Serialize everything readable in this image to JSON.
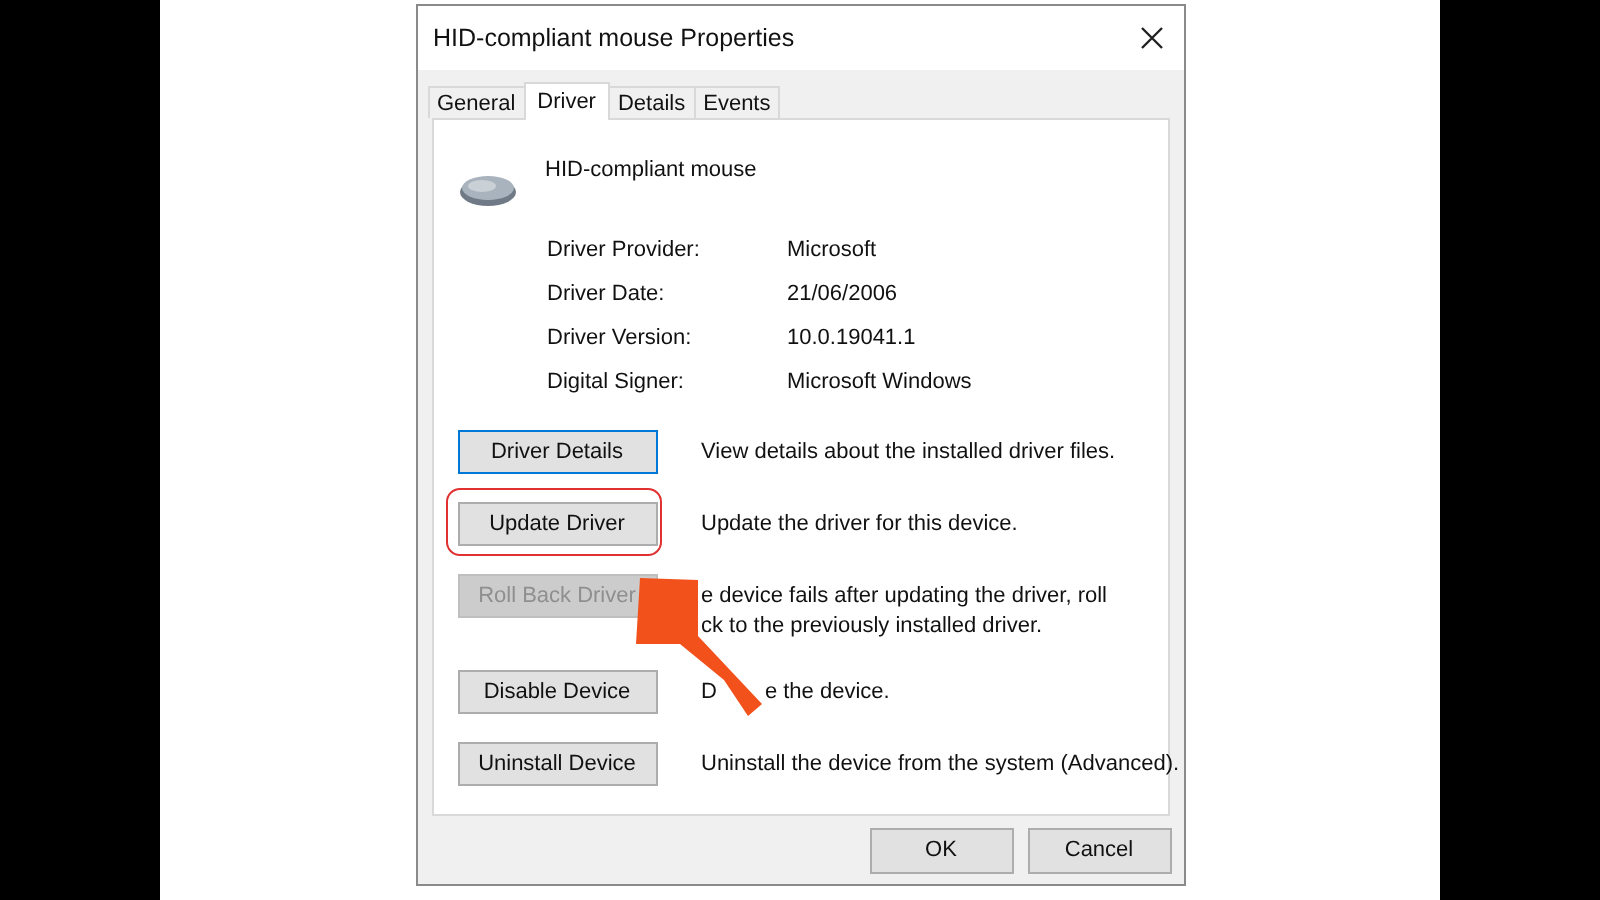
{
  "window": {
    "title": "HID-compliant mouse Properties"
  },
  "tabs": [
    {
      "label": "General",
      "selected": false
    },
    {
      "label": "Driver",
      "selected": true
    },
    {
      "label": "Details",
      "selected": false
    },
    {
      "label": "Events",
      "selected": false
    }
  ],
  "device": {
    "name": "HID-compliant mouse"
  },
  "properties": [
    {
      "label": "Driver Provider:",
      "value": "Microsoft"
    },
    {
      "label": "Driver Date:",
      "value": "21/06/2006"
    },
    {
      "label": "Driver Version:",
      "value": "10.0.19041.1"
    },
    {
      "label": "Digital Signer:",
      "value": "Microsoft Windows"
    }
  ],
  "actions": [
    {
      "label": "Driver Details",
      "disabled": false,
      "focused": true,
      "highlighted": false,
      "description": [
        [
          "View details about the installed driver files."
        ]
      ]
    },
    {
      "label": "Update Driver",
      "disabled": false,
      "focused": false,
      "highlighted": true,
      "description": [
        [
          "Update the driver for this device."
        ]
      ]
    },
    {
      "label": "Roll Back Driver",
      "disabled": true,
      "focused": false,
      "highlighted": false,
      "description": [
        [
          "e device fails after updating the driver, roll"
        ],
        [
          "ck to the previously installed driver."
        ]
      ]
    },
    {
      "label": "Disable Device",
      "disabled": false,
      "focused": false,
      "highlighted": false,
      "description": [
        [
          "D",
          "e the device."
        ]
      ]
    },
    {
      "label": "Uninstall Device",
      "disabled": false,
      "focused": false,
      "highlighted": false,
      "description": [
        [
          "Uninstall the device from the system (Advanced)."
        ]
      ]
    }
  ],
  "buttons": [
    "OK",
    "Cancel"
  ]
}
